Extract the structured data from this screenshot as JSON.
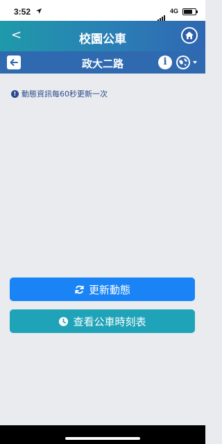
{
  "status_bar": {
    "time": "3:52",
    "network": "4G"
  },
  "header": {
    "back_label": "<",
    "title": "校園公車"
  },
  "route_bar": {
    "route_name": "政大二路",
    "info_label": "i"
  },
  "notice": {
    "text": "動態資訊每60秒更新一次"
  },
  "actions": {
    "refresh_label": "更新動態",
    "schedule_label": "查看公車時刻表"
  },
  "icons": {
    "home": "home-icon",
    "back_arrow": "arrow-left-icon",
    "info": "info-icon",
    "language": "globe-icon",
    "refresh": "refresh-icon",
    "clock": "clock-icon",
    "notice": "exclamation-circle-icon"
  },
  "colors": {
    "header_start": "#1f9aaa",
    "header_end": "#2f67b3",
    "subbar": "#2f6ab0",
    "refresh_button": "#1a84f7",
    "schedule_button": "#1fa3b8",
    "notice_text": "#2b4a8c",
    "background": "#e9ebef"
  }
}
